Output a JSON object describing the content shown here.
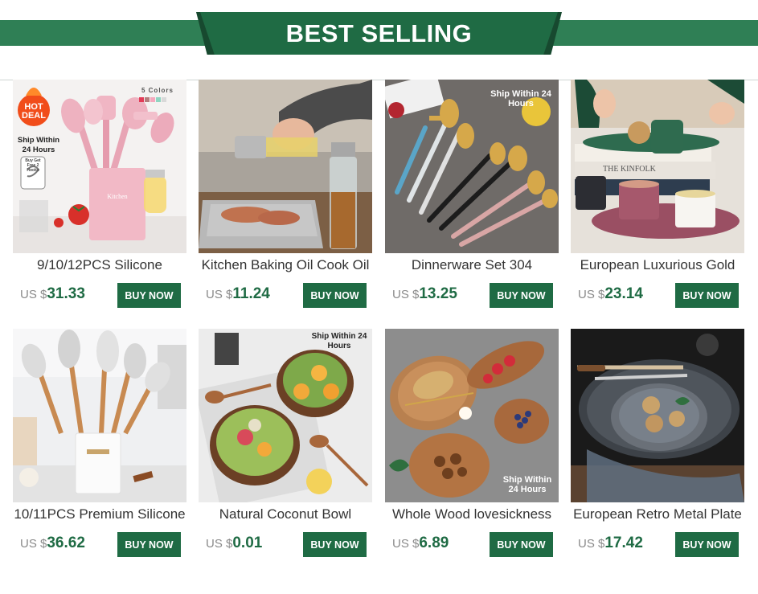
{
  "banner": {
    "title": "BEST SELLING"
  },
  "currency": "US $",
  "buy_label": "BUY NOW",
  "colors": {
    "brand_green": "#1f6b44",
    "stripe_green": "#2f7f55"
  },
  "products": [
    {
      "title": "9/10/12PCS Silicone",
      "price": "31.33",
      "image": "pink-silicone-utensil-set",
      "overlay": {
        "hot_deal": "HOT DEAL",
        "ship": "Ship Within 24 Hours",
        "colors": "5 Colors",
        "hooks": "Buy Get Free 2 Hooks"
      }
    },
    {
      "title": "Kitchen Baking Oil Cook Oil",
      "price": "11.24",
      "image": "oil-sprayer-bottle"
    },
    {
      "title": "Dinnerware Set 304",
      "price": "13.25",
      "image": "gold-cutlery-set",
      "overlay": {
        "ship": "Ship Within 24 Hours"
      }
    },
    {
      "title": "European Luxurious Gold",
      "price": "23.14",
      "image": "ceramic-mug-set"
    },
    {
      "title": "10/11PCS Premium Silicone",
      "price": "36.62",
      "image": "white-silicone-utensil-set"
    },
    {
      "title": "Natural Coconut Bowl",
      "price": "0.01",
      "image": "coconut-bowls",
      "overlay": {
        "ship": "Ship Within 24 Hours"
      }
    },
    {
      "title": "Whole Wood lovesickness",
      "price": "6.89",
      "image": "wooden-plates",
      "overlay": {
        "ship": "Ship Within 24 Hours"
      }
    },
    {
      "title": "European Retro Metal Plate",
      "price": "17.42",
      "image": "retro-metal-plates"
    }
  ]
}
